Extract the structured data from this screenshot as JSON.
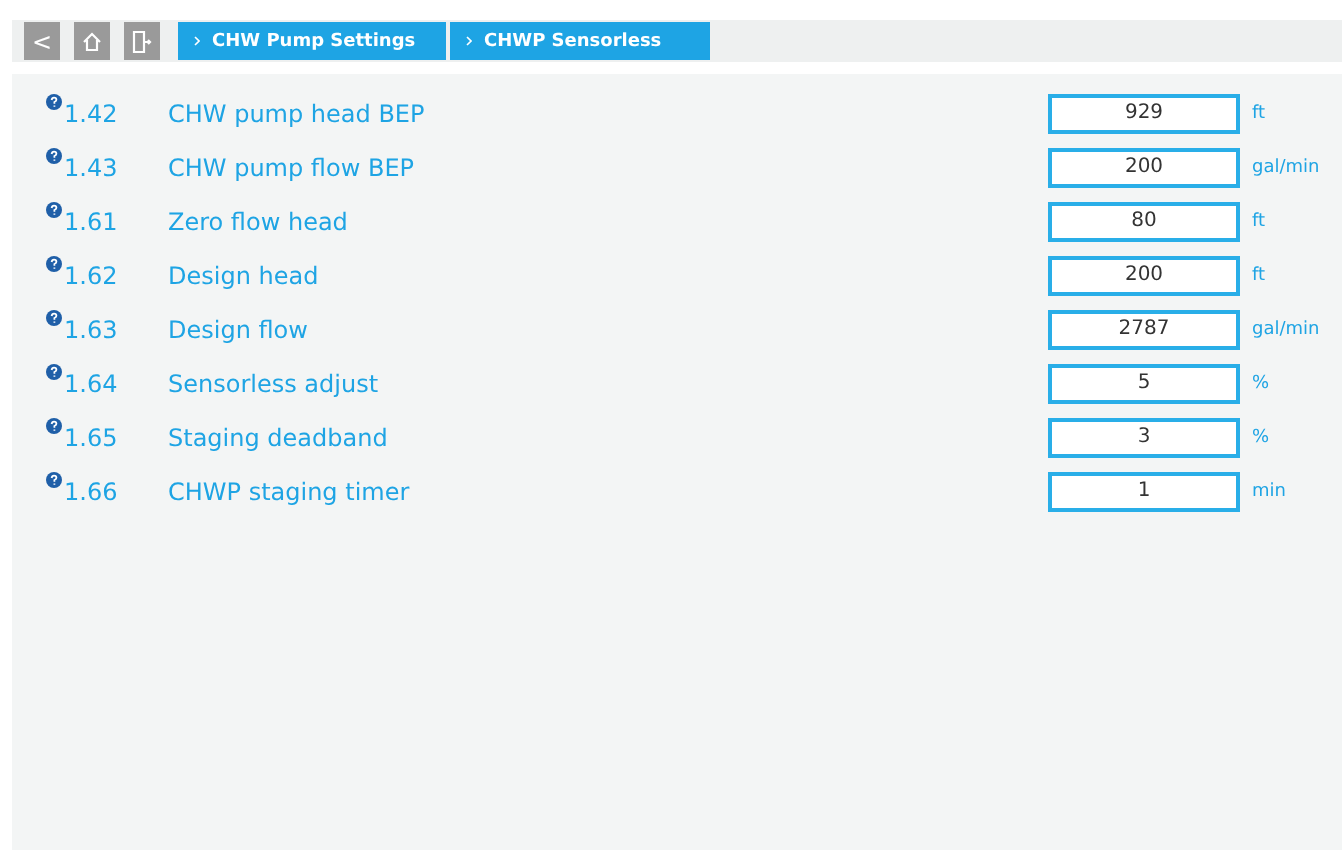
{
  "toolbar": {
    "buttons": [
      {
        "kind": "back",
        "label": "<"
      },
      {
        "kind": "home"
      },
      {
        "kind": "exit"
      }
    ]
  },
  "breadcrumbs": [
    "CHW Pump Settings",
    "CHWP Sensorless"
  ],
  "parameters": [
    {
      "number": "1.42",
      "name": "CHW pump head BEP",
      "value": "929",
      "unit": "ft"
    },
    {
      "number": "1.43",
      "name": "CHW pump flow BEP",
      "value": "200",
      "unit": "gal/min"
    },
    {
      "number": "1.61",
      "name": "Zero flow head",
      "value": "80",
      "unit": "ft"
    },
    {
      "number": "1.62",
      "name": "Design head",
      "value": "200",
      "unit": "ft"
    },
    {
      "number": "1.63",
      "name": "Design flow",
      "value": "2787",
      "unit": "gal/min"
    },
    {
      "number": "1.64",
      "name": "Sensorless adjust",
      "value": "5",
      "unit": "%"
    },
    {
      "number": "1.65",
      "name": "Staging deadband",
      "value": "3",
      "unit": "%"
    },
    {
      "number": "1.66",
      "name": "CHWP staging timer",
      "value": "1",
      "unit": "min"
    }
  ]
}
